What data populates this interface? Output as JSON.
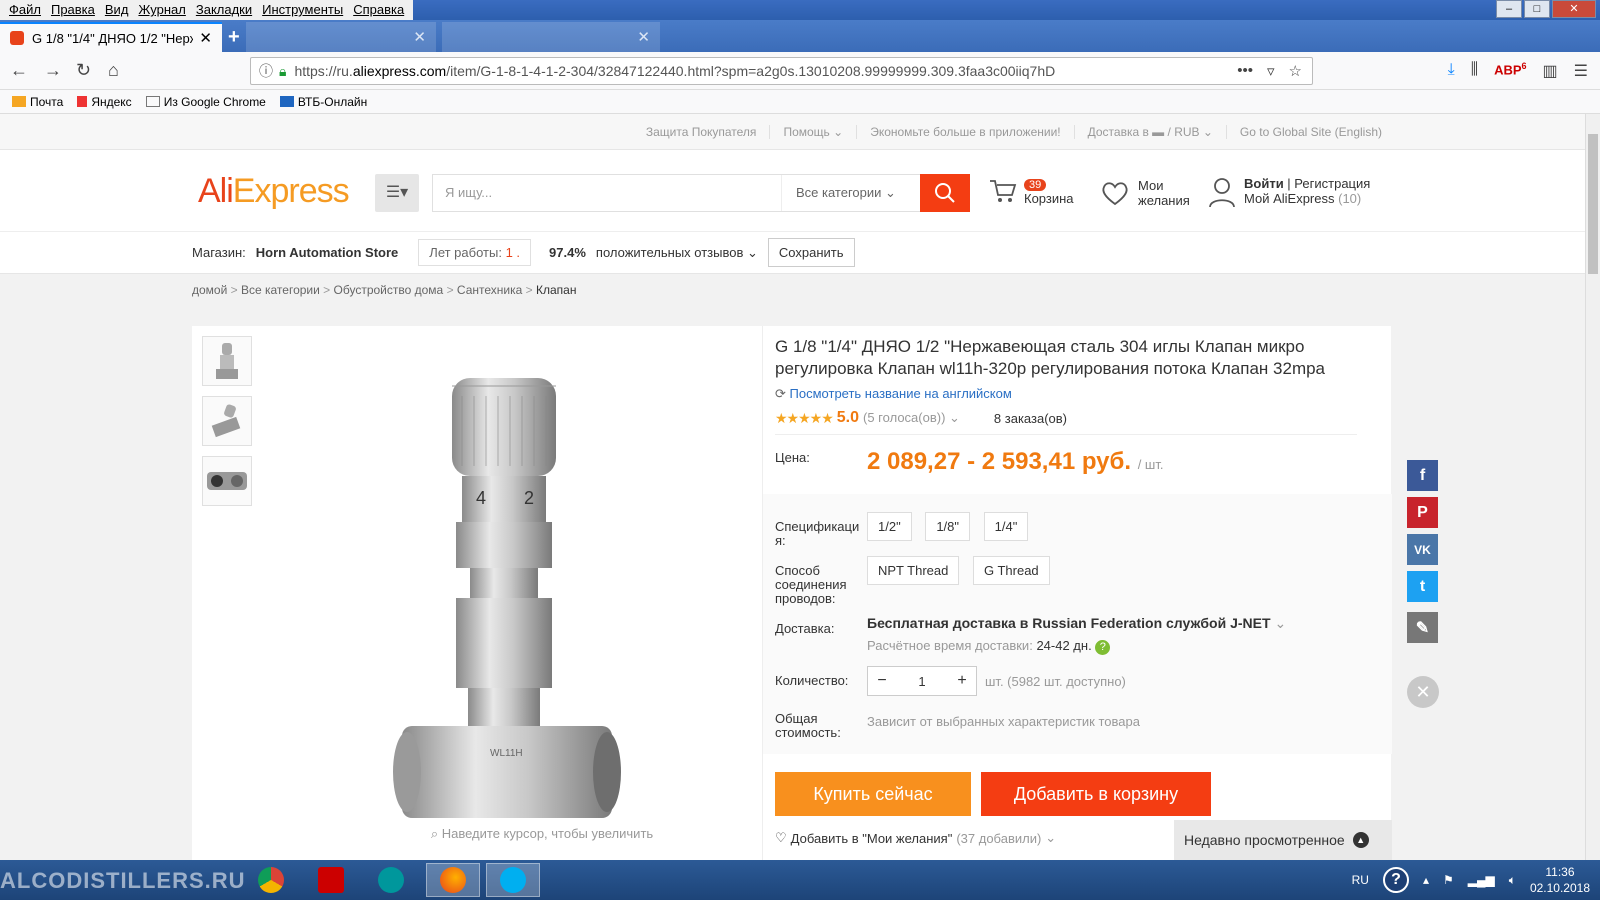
{
  "browser": {
    "menu": [
      "Файл",
      "Правка",
      "Вид",
      "Журнал",
      "Закладки",
      "Инструменты",
      "Справка"
    ],
    "active_tab_title": "G 1/8 \"1/4\" ДНЯО 1/2 \"Нержав",
    "url_prefix": "https://ru.",
    "url_domain": "aliexpress.com",
    "url_rest": "/item/G-1-8-1-4-1-2-304/32847122440.html?spm=a2g0s.13010208.99999999.309.3faa3c00iiq7hD",
    "ext_badge": "6",
    "bookmarks": [
      "Почта",
      "Яндекс",
      "Из Google Chrome",
      "ВТБ-Онлайн"
    ]
  },
  "topbar": {
    "items": [
      "Защита Покупателя",
      "Помощь ⌄",
      "Экономьте больше в приложении!",
      "Доставка в ▬ / RUB ⌄",
      "Go to Global Site (English)"
    ]
  },
  "header": {
    "logo_a": "Ali",
    "logo_b": "Express",
    "search_placeholder": "Я ищу...",
    "search_category": "Все категории",
    "cart_count": "39",
    "cart_label": "Корзина",
    "wish_label_1": "Мои",
    "wish_label_2": "желания",
    "login": "Войти",
    "register": "Регистрация",
    "my_ali": "Мой AliExpress",
    "my_ali_count": "(10)"
  },
  "store": {
    "label": "Магазин:",
    "name": "Horn Automation Store",
    "years_label": "Лет работы:",
    "years_value": "1",
    "positive_pct": "97.4%",
    "positive_label": "положительных отзывов",
    "save_label": "Сохранить"
  },
  "breadcrumb": [
    "домой",
    "Все категории",
    "Обустройство дома",
    "Сантехника",
    "Клапан"
  ],
  "product": {
    "title": "G 1/8 \"1/4\" ДНЯО 1/2 \"Нержавеющая сталь 304 иглы Клапан микро регулировка Клапан wl11h-320p регулирования потока Клапан 32mpa",
    "translate_link": "Посмотреть название на английском",
    "stars": "★★★★★",
    "rating": "5.0",
    "votes": "(5 голоса(ов))",
    "orders": "8 заказа(ов)",
    "price_label": "Цена:",
    "price": "2 089,27 - 2 593,41 руб.",
    "price_unit": "/ шт.",
    "spec_label": "Спецификаци я:",
    "specs": [
      "1/2\"",
      "1/8\"",
      "1/4\""
    ],
    "conn_label": "Способ соединения проводов:",
    "connections": [
      "NPT Thread",
      "G Thread"
    ],
    "delivery_label": "Доставка:",
    "delivery_text": "Бесплатная доставка в Russian Federation службой J-NET",
    "eta_label": "Расчётное время доставки:",
    "eta_value": "24-42 дн.",
    "qty_label": "Количество:",
    "qty_value": "1",
    "qty_avail": "шт. (5982 шт. доступно)",
    "total_label": "Общая стоимость:",
    "total_value": "Зависит от выбранных характеристик товара",
    "buy_now": "Купить сейчас",
    "add_cart": "Добавить в корзину",
    "wish_add": "Добавить в \"Мои желания\"",
    "wish_count": "(37 добавили)",
    "zoom_hint": "Наведите курсор, чтобы увеличить",
    "recent": "Недавно просмотренное"
  },
  "taskbar": {
    "watermark": "ALCODISTILLERS.RU",
    "lang": "RU",
    "time": "11:36",
    "date": "02.10.2018"
  },
  "colors": {
    "accent": "#f43d12",
    "price": "#f07a10",
    "buy": "#f8901e"
  }
}
